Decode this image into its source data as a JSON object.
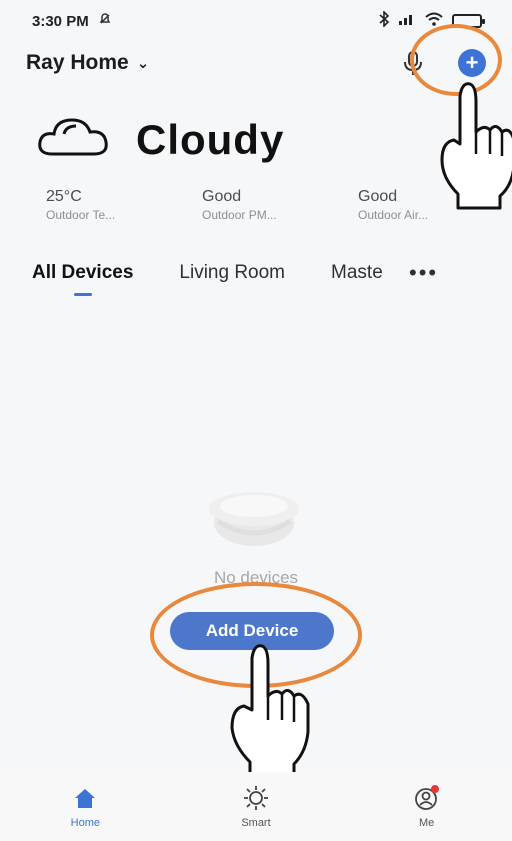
{
  "status_bar": {
    "time": "3:30 PM",
    "icons": [
      "alarm-off-icon",
      "bluetooth-icon",
      "signal-icon",
      "wifi-icon",
      "battery-icon"
    ]
  },
  "header": {
    "home_name": "Ray Home",
    "chevron": "⌄",
    "mic_icon": "microphone-icon",
    "plus_icon": "plus-icon",
    "plus_label": "+"
  },
  "weather": {
    "condition": "Cloudy",
    "icon": "cloud-icon",
    "metrics": [
      {
        "value": "25°C",
        "label": "Outdoor Te..."
      },
      {
        "value": "Good",
        "label": "Outdoor PM..."
      },
      {
        "value": "Good",
        "label": "Outdoor Air..."
      }
    ]
  },
  "tabs": [
    {
      "label": "All Devices"
    },
    {
      "label": "Living Room"
    },
    {
      "label": "Maste"
    }
  ],
  "more_label": "•••",
  "empty_state": {
    "text": "No devices",
    "button_label": "Add Device"
  },
  "bottom_nav": [
    {
      "label": "Home",
      "icon": "home-icon"
    },
    {
      "label": "Smart",
      "icon": "sun-icon"
    },
    {
      "label": "Me",
      "icon": "user-icon"
    }
  ],
  "colors": {
    "accent": "#3d73d6",
    "highlight": "#e9893e",
    "background": "#f6f7f9"
  }
}
